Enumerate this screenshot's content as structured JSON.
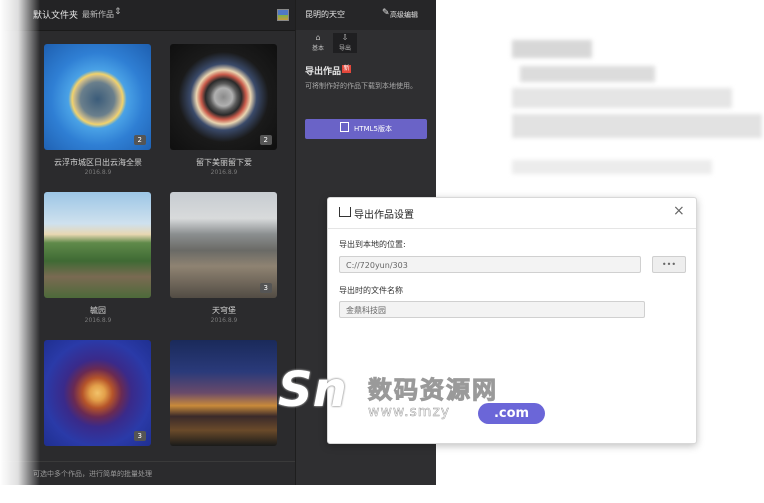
{
  "header": {
    "folder_label": "默认文件夹",
    "sort_label": "最新作品",
    "sort_chevron": "⇕"
  },
  "works": [
    {
      "title": "云浮市城区日出云海全景",
      "date": "2016.8.9",
      "count": "2"
    },
    {
      "title": "留下美丽留下爱",
      "date": "2016.8.9",
      "count": "2"
    },
    {
      "title": "毓园",
      "date": "2016.8.9",
      "count": ""
    },
    {
      "title": "天穹堡",
      "date": "2016.8.9",
      "count": "3"
    },
    {
      "title": "",
      "date": "",
      "count": "3"
    },
    {
      "title": "",
      "date": "",
      "count": ""
    }
  ],
  "bottom_hint": "可选中多个作品，进行简单的批量处理",
  "right_panel": {
    "user_name": "昆明的天空",
    "advanced_edit": "高级编辑",
    "wrench_icon": "wrench-icon",
    "tabs": [
      {
        "label": "基本",
        "icon": "⌂"
      },
      {
        "label": "导出",
        "icon": "⇩"
      }
    ],
    "export_title": "导出作品",
    "new_badge": "新",
    "export_desc": "可将制作好的作品下载到本地使用。",
    "html5_button": "HTML5版本"
  },
  "dialog": {
    "title": "导出作品设置",
    "close": "×",
    "location_label": "导出到本地的位置:",
    "location_value": "C://720yun/303",
    "browse_label": "•••",
    "filename_label": "导出时的文件名称",
    "filename_value": "金鼎科技园"
  },
  "watermark": {
    "logo": "Sn",
    "cn": "数码资源网",
    "url": "www.smzy",
    "com": ".com"
  },
  "colors": {
    "accent": "#6a63c7",
    "panel_bg": "#2b2b2d",
    "badge_red": "#e2473b"
  }
}
